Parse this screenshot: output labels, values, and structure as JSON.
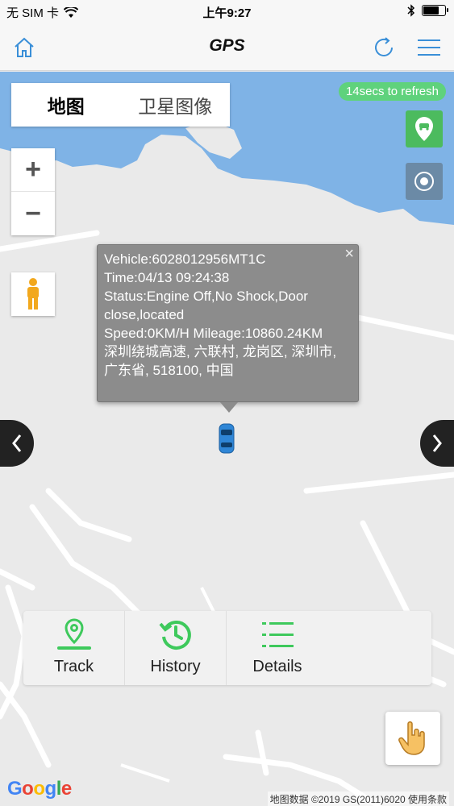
{
  "status_bar": {
    "carrier": "无 SIM 卡",
    "time": "上午9:27",
    "battery_level": 0.75
  },
  "nav": {
    "title": "GPS",
    "home_icon": "home-icon",
    "refresh_icon": "refresh-icon",
    "menu_icon": "menu-icon"
  },
  "map": {
    "map_type_tabs": [
      {
        "label": "地图",
        "active": true
      },
      {
        "label": "卫星图像",
        "active": false
      }
    ],
    "refresh_countdown": "14secs to refresh",
    "zoom_in": "+",
    "zoom_out": "−",
    "info_window": {
      "vehicle": "Vehicle:6028012956MT1C",
      "time": "Time:04/13 09:24:38",
      "status": "Status:Engine Off,No Shock,Door close,located",
      "speed_mileage": "Speed:0KM/H Mileage:10860.24KM",
      "address": "深圳绕城高速, 六联村, 龙岗区, 深圳市, 广东省, 518100, 中国",
      "close": "×"
    },
    "google_logo": "Google",
    "attribution": "地图数据 ©2019 GS(2011)6020  使用条款"
  },
  "actions": [
    {
      "label": "Track",
      "icon": "track-icon"
    },
    {
      "label": "History",
      "icon": "history-icon"
    },
    {
      "label": "Details",
      "icon": "details-icon"
    }
  ],
  "colors": {
    "accent_blue": "#3a8fd8",
    "green": "#3ec95c",
    "water": "#7fb3e6",
    "info_bg": "#8c8c8c"
  }
}
